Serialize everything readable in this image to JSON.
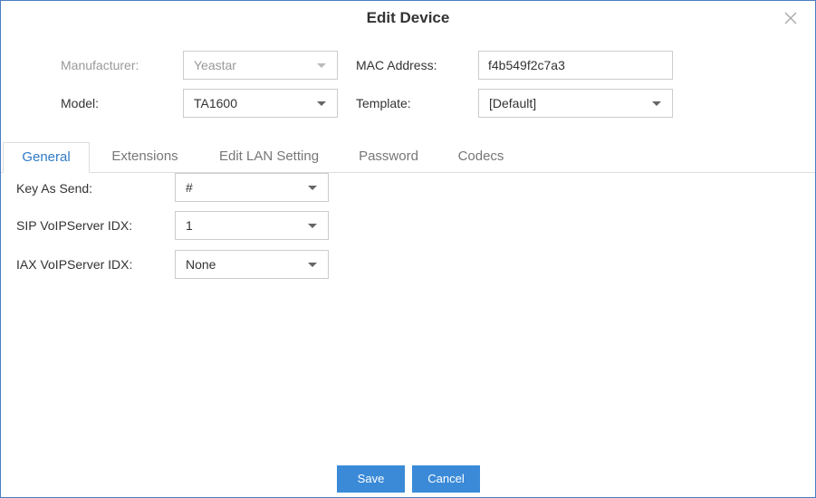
{
  "dialog": {
    "title": "Edit Device"
  },
  "header_fields": {
    "manufacturer": {
      "label": "Manufacturer:",
      "value": "Yeastar"
    },
    "mac_address": {
      "label": "MAC Address:",
      "value": "f4b549f2c7a3"
    },
    "model": {
      "label": "Model:",
      "value": "TA1600"
    },
    "template": {
      "label": "Template:",
      "value": "[Default]"
    }
  },
  "tabs": [
    {
      "label": "General",
      "active": true
    },
    {
      "label": "Extensions",
      "active": false
    },
    {
      "label": "Edit LAN Setting",
      "active": false
    },
    {
      "label": "Password",
      "active": false
    },
    {
      "label": "Codecs",
      "active": false
    }
  ],
  "general": {
    "key_as_send": {
      "label": "Key As Send:",
      "value": "#"
    },
    "sip_voip_server_idx": {
      "label": "SIP VoIPServer IDX:",
      "value": "1"
    },
    "iax_voip_server_idx": {
      "label": "IAX VoIPServer IDX:",
      "value": "None"
    }
  },
  "buttons": {
    "save": "Save",
    "cancel": "Cancel"
  },
  "colors": {
    "accent": "#3a8ad8",
    "active_tab": "#2f7cc4",
    "border": "#4a7fc1"
  }
}
